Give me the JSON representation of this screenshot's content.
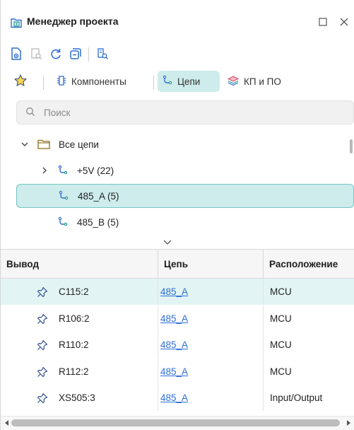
{
  "window": {
    "title": "Менеджер проекта",
    "title_icon": "project-manager-icon",
    "maximize_icon": "maximize-icon",
    "close_icon": "close-icon"
  },
  "toolbar": {
    "icons": [
      "document-view-icon",
      "zoom-page-icon",
      "refresh-icon",
      "collapse-icon",
      "find-icon"
    ]
  },
  "tabs": [
    {
      "label": "",
      "icon": "star-icon",
      "active": false
    },
    {
      "label": "Компоненты",
      "icon": "component-icon",
      "active": false
    },
    {
      "label": "Цепи",
      "icon": "net-icon",
      "active": true
    },
    {
      "label": "КП и ПО",
      "icon": "layers-icon",
      "active": false
    }
  ],
  "search": {
    "placeholder": "Поиск",
    "value": ""
  },
  "tree": {
    "root": {
      "label": "Все цепи",
      "expanded": true,
      "icon": "folder-icon"
    },
    "items": [
      {
        "label": "+5V (22)",
        "expandable": true,
        "selected": false,
        "icon": "net-icon"
      },
      {
        "label": "485_A (5)",
        "expandable": false,
        "selected": true,
        "icon": "net-icon"
      },
      {
        "label": "485_B (5)",
        "expandable": false,
        "selected": false,
        "icon": "net-icon"
      }
    ]
  },
  "table": {
    "columns": [
      "Вывод",
      "Цепь",
      "Расположение"
    ],
    "rows": [
      {
        "pin": "C115:2",
        "net": "485_A",
        "location": "MCU"
      },
      {
        "pin": "R106:2",
        "net": "485_A",
        "location": "MCU"
      },
      {
        "pin": "R110:2",
        "net": "485_A",
        "location": "MCU"
      },
      {
        "pin": "R112:2",
        "net": "485_A",
        "location": "MCU"
      },
      {
        "pin": "XS505:3",
        "net": "485_A",
        "location": "Input/Output"
      }
    ]
  },
  "colors": {
    "accent_bg": "#cdeceb",
    "accent_border": "#76c4c2",
    "link": "#2b6fd6",
    "icon_blue": "#2f6fd0",
    "icon_teal": "#1f9a93"
  }
}
